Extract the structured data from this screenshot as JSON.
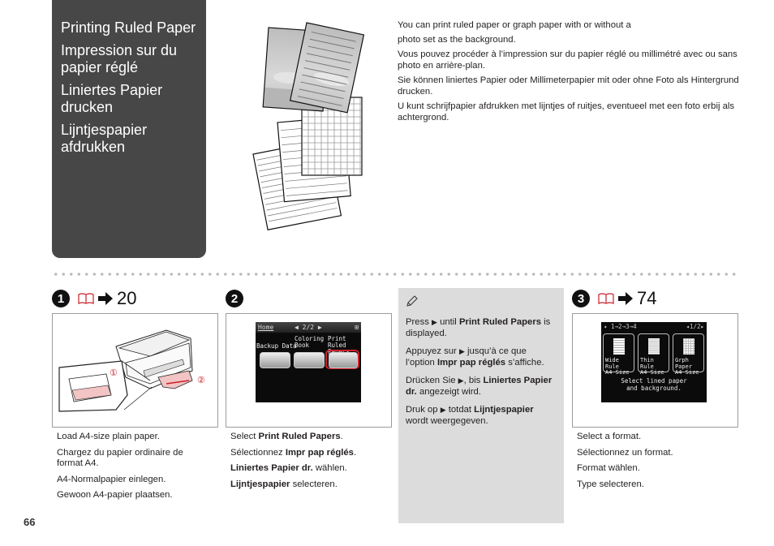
{
  "title_panel": {
    "headings": [
      "Printing Ruled Paper",
      "Impression sur du papier réglé",
      "Liniertes Papier drucken",
      "Lijntjespapier afdrukken"
    ],
    "color": "#474747"
  },
  "intro": {
    "paragraphs": [
      "You can print ruled paper or graph paper with or without a",
      "photo set as the background.",
      "Vous pouvez procéder à l’impression sur du papier réglé ou millimétré avec ou sans photo en arrière-plan.",
      "Sie können liniertes Papier oder Millimeterpapier mit oder ohne Foto als Hintergrund drucken.",
      "U kunt schrijfpapier afdrukken met lijntjes of ruitjes, eventueel met een foto erbij als achtergrond."
    ]
  },
  "illustration": {
    "label": "ruled-and-graph-paper-samples"
  },
  "steps": [
    {
      "number": "1",
      "page_ref": "20",
      "figure": {
        "callouts": [
          "①",
          "②"
        ]
      },
      "captions": [
        "Load A4-size plain paper.",
        "Chargez du papier ordinaire de format A4.",
        "A4-Normalpapier einlegen.",
        "Gewoon A4-papier plaatsen."
      ]
    },
    {
      "number": "2",
      "lcd": {
        "header_left": "Home",
        "header_center": "◀ 2/2 ▶",
        "items": [
          {
            "label": "Backup Data",
            "label2": ""
          },
          {
            "label": "Coloring",
            "label2": "Book"
          },
          {
            "label": "Print Ruled",
            "label2": "Papers"
          }
        ],
        "highlight_color": "#d0202a"
      },
      "captions": [
        {
          "pre": "Select ",
          "bold": "Print Ruled Papers",
          "post": "."
        },
        {
          "pre": "Sélectionnez ",
          "bold": "Impr pap réglés",
          "post": "."
        },
        {
          "pre": "",
          "bold": "Liniertes Papier dr.",
          "post": " wählen."
        },
        {
          "pre": "",
          "bold": "Lijntjespapier",
          "post": " selecteren."
        }
      ]
    },
    {
      "number": "3",
      "page_ref": "74",
      "lcd": {
        "header_steps": "1→2→3→4",
        "header_page": "1/2",
        "items": [
          {
            "label": "Wide Rule",
            "label2": "A4 Size"
          },
          {
            "label": "Thin Rule",
            "label2": "A4 Size"
          },
          {
            "label": "Grph Paper",
            "label2": "A4 Size"
          }
        ],
        "message": "Select lined paper and background."
      },
      "captions": [
        "Select a format.",
        "Sélectionnez un format.",
        "Format wählen.",
        "Type selecteren."
      ]
    }
  ],
  "note": {
    "bg": "#dcdcdc",
    "items": [
      {
        "pre": "Press ",
        "tri": "▶",
        "mid": " until ",
        "bold": "Print Ruled Papers",
        "post": " is displayed."
      },
      {
        "pre": "Appuyez sur ",
        "tri": "▶",
        "mid": " jusqu’à ce que l’option ",
        "bold": "Impr pap réglés",
        "post": " s’affiche."
      },
      {
        "pre": "Drücken Sie ",
        "tri": "▶",
        "mid": ", bis ",
        "bold": "Liniertes Papier dr.",
        "post": " angezeigt wird."
      },
      {
        "pre": "Druk op ",
        "tri": "▶",
        "mid": " totdat ",
        "bold": "Lijntjespapier",
        "post": " wordt weergegeven."
      }
    ]
  },
  "page_number": "66",
  "accent_red": "#c8202a"
}
